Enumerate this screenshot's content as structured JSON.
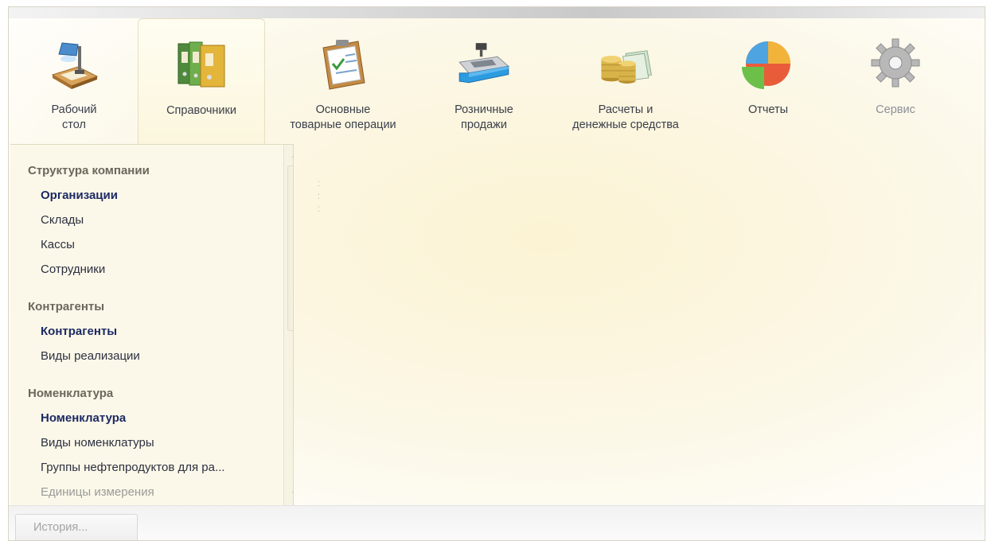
{
  "sections": [
    {
      "id": "desktop",
      "label": "Рабочий\nстол",
      "icon": "desk-lamp-icon",
      "active": false
    },
    {
      "id": "catalogs",
      "label": "Справочники",
      "icon": "binders-icon",
      "active": true
    },
    {
      "id": "operations",
      "label": "Основные\nтоварные операции",
      "icon": "clipboard-checklist-icon",
      "active": false
    },
    {
      "id": "retail",
      "label": "Розничные\nпродажи",
      "icon": "cash-register-icon",
      "active": false
    },
    {
      "id": "finance",
      "label": "Расчеты и\nденежные средства",
      "icon": "coins-banknotes-icon",
      "active": false
    },
    {
      "id": "reports",
      "label": "Отчеты",
      "icon": "pie-chart-icon",
      "active": false
    },
    {
      "id": "service",
      "label": "Сервис",
      "icon": "gear-icon",
      "active": false
    }
  ],
  "nav": {
    "groups": [
      {
        "title": "Структура компании",
        "items": [
          {
            "label": "Организации",
            "style": "bold"
          },
          {
            "label": "Склады",
            "style": "normal"
          },
          {
            "label": "Кассы",
            "style": "normal"
          },
          {
            "label": "Сотрудники",
            "style": "normal"
          }
        ]
      },
      {
        "title": "Контрагенты",
        "items": [
          {
            "label": "Контрагенты",
            "style": "bold"
          },
          {
            "label": "Виды реализации",
            "style": "normal"
          }
        ]
      },
      {
        "title": "Номенклатура",
        "items": [
          {
            "label": "Номенклатура",
            "style": "bold"
          },
          {
            "label": "Виды номенклатуры",
            "style": "normal"
          },
          {
            "label": "Группы нефтепродуктов для ра...",
            "style": "normal"
          },
          {
            "label": "Единицы измерения",
            "style": "dim"
          }
        ]
      }
    ]
  },
  "bottom": {
    "history_label": "История..."
  }
}
